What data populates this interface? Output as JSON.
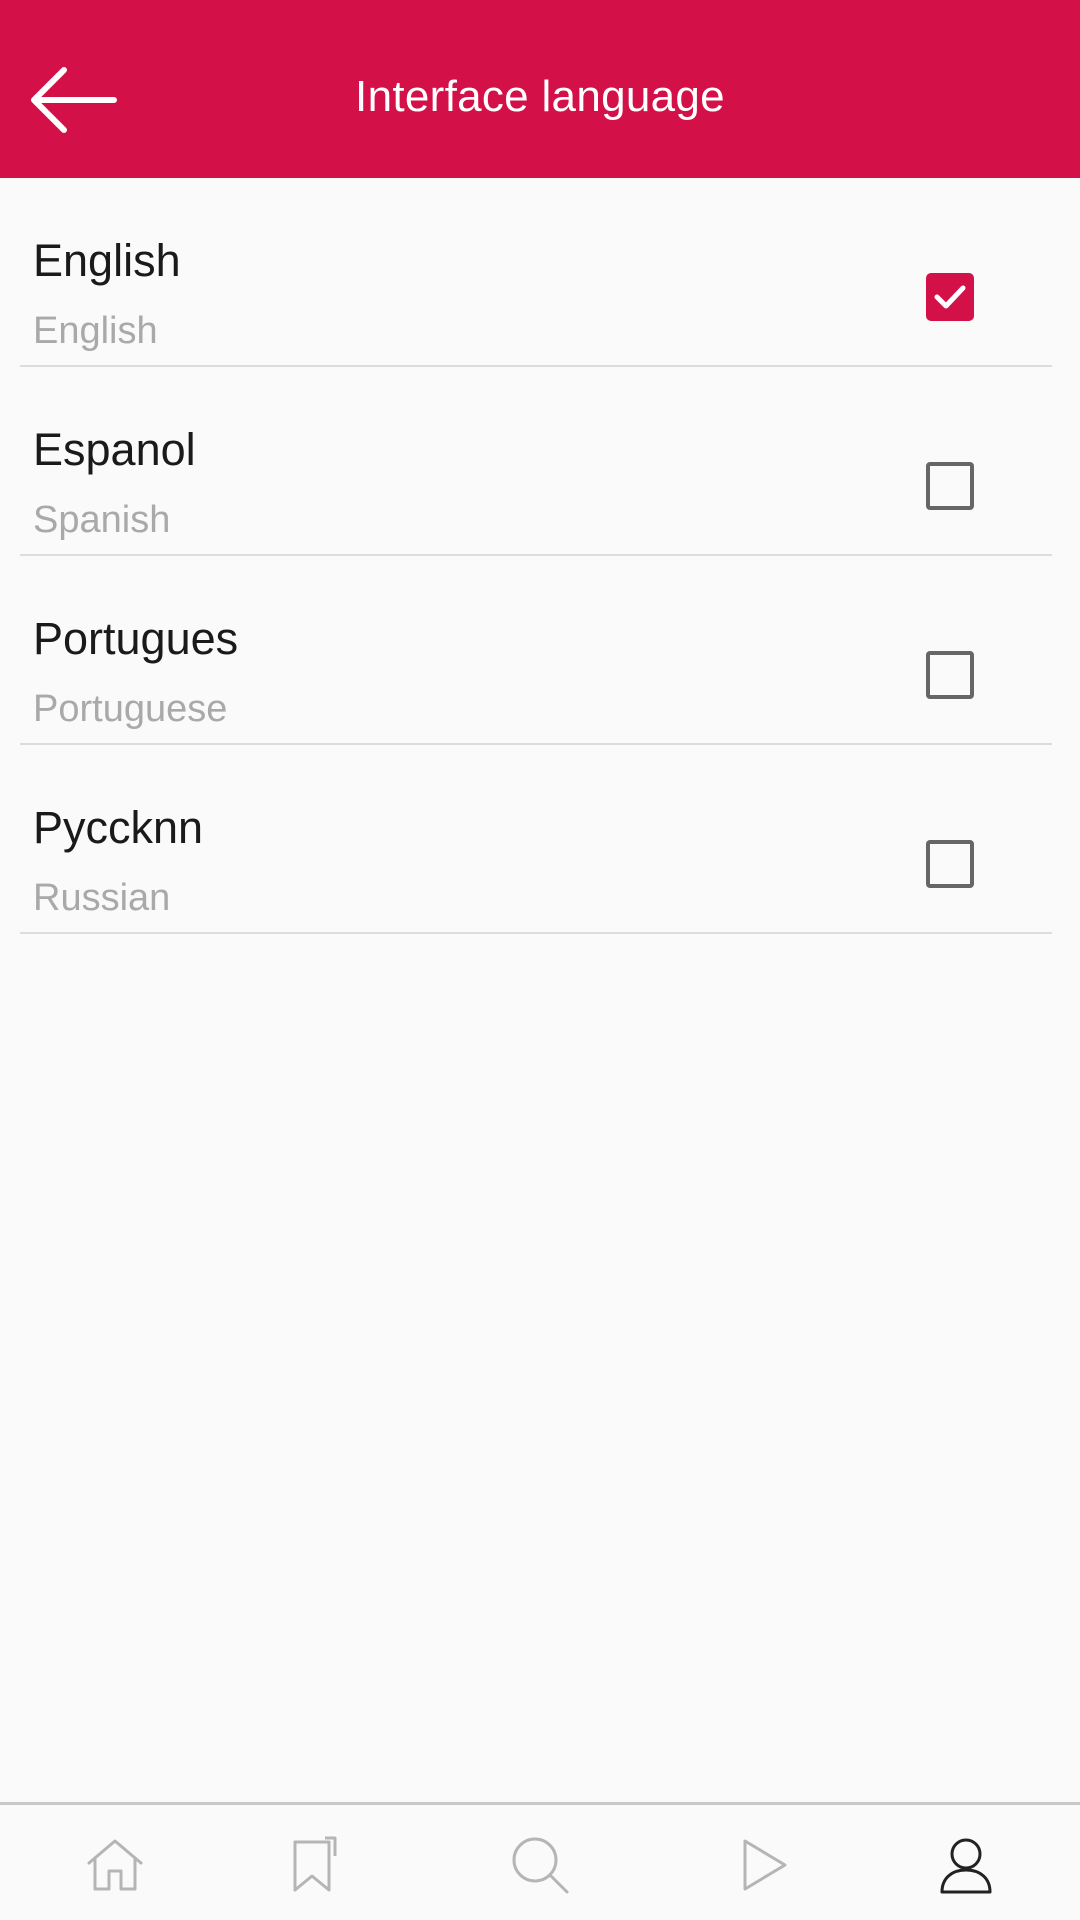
{
  "header": {
    "title": "Interface language",
    "back_icon": "arrow-left-icon",
    "background_color": "#d31148"
  },
  "languages": [
    {
      "native": "English",
      "english": "English",
      "checked": true
    },
    {
      "native": "Espanol",
      "english": "Spanish",
      "checked": false
    },
    {
      "native": "Portugues",
      "english": "Portuguese",
      "checked": false
    },
    {
      "native": "Pyccknn",
      "english": "Russian",
      "checked": false
    }
  ],
  "bottom_nav": {
    "items": [
      {
        "icon": "home-icon",
        "active": false
      },
      {
        "icon": "bookmark-icon",
        "active": false
      },
      {
        "icon": "search-icon",
        "active": false
      },
      {
        "icon": "play-icon",
        "active": false
      },
      {
        "icon": "profile-icon",
        "active": true
      }
    ]
  },
  "colors": {
    "accent": "#d31148",
    "inactive_icon": "#b5b5b5",
    "active_icon": "#222222"
  }
}
